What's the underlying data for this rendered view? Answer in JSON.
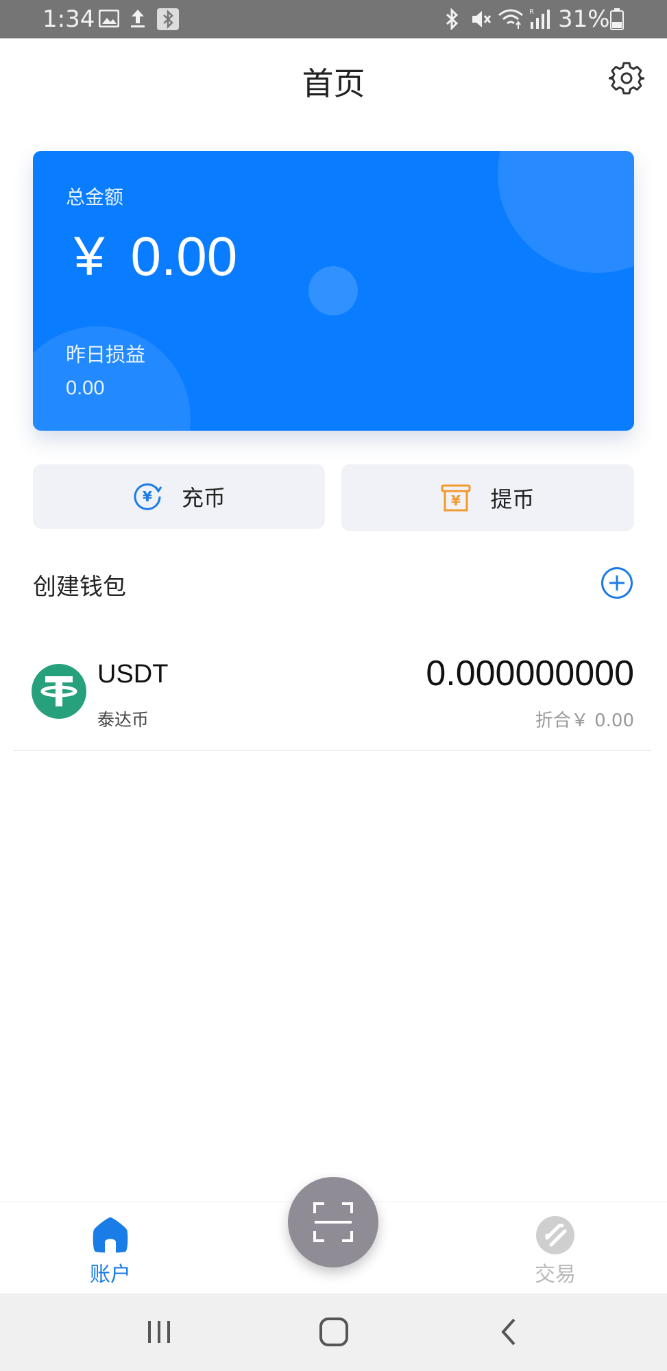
{
  "status_bar": {
    "time": "1:34",
    "battery_percent": "31%",
    "left_icons": [
      "image-icon",
      "upload-icon",
      "bluetooth-box-icon"
    ],
    "right_icons": [
      "bluetooth-icon",
      "mute-icon",
      "wifi-icon",
      "signal-icon",
      "battery-icon"
    ]
  },
  "header": {
    "title": "首页",
    "settings_icon": "gear-icon"
  },
  "balance_card": {
    "total_label": "总金额",
    "currency_symbol": "¥",
    "total_value": "0.00",
    "yesterday_label": "昨日损益",
    "yesterday_value": "0.00",
    "accent_color": "#0a7cff"
  },
  "actions": {
    "deposit_label": "充币",
    "withdraw_label": "提币",
    "deposit_icon_color": "#1a7ce6",
    "withdraw_icon_color": "#f29a2e"
  },
  "wallets": {
    "section_title": "创建钱包",
    "add_icon": "plus-circle-icon",
    "items": [
      {
        "symbol": "USDT",
        "name": "泰达币",
        "amount": "0.000000000",
        "fiat": "折合￥ 0.00",
        "logo_color": "#26a17b"
      }
    ]
  },
  "bottom_nav": {
    "items": [
      {
        "label": "账户",
        "icon": "home-icon",
        "active": true
      },
      {
        "label": "交易",
        "icon": "trade-icon",
        "active": false
      }
    ],
    "scan_icon": "scan-icon",
    "active_color": "#1a7ce6"
  },
  "system_nav": {
    "buttons": [
      "recents-icon",
      "home-button-icon",
      "back-icon"
    ]
  }
}
